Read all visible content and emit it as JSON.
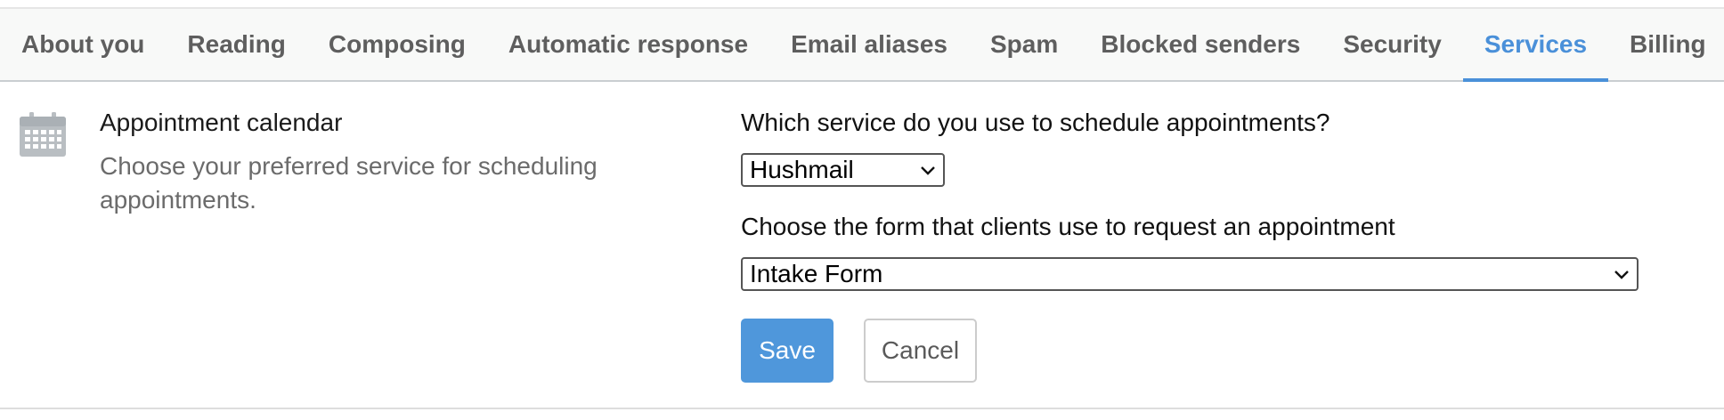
{
  "tabs": [
    {
      "label": "About you",
      "active": false
    },
    {
      "label": "Reading",
      "active": false
    },
    {
      "label": "Composing",
      "active": false
    },
    {
      "label": "Automatic response",
      "active": false
    },
    {
      "label": "Email aliases",
      "active": false
    },
    {
      "label": "Spam",
      "active": false
    },
    {
      "label": "Blocked senders",
      "active": false
    },
    {
      "label": "Security",
      "active": false
    },
    {
      "label": "Services",
      "active": true
    },
    {
      "label": "Billing",
      "active": false
    }
  ],
  "section": {
    "icon": "calendar-icon",
    "title": "Appointment calendar",
    "description": "Choose your preferred service for scheduling appointments.",
    "service_label": "Which service do you use to schedule appointments?",
    "service_value": "Hushmail",
    "form_label": "Choose the form that clients use to request an appointment",
    "form_value": "Intake Form",
    "save_label": "Save",
    "cancel_label": "Cancel"
  },
  "colors": {
    "accent": "#4a90d9",
    "save_button": "#4f97db",
    "tab_text": "#5e5e5e"
  }
}
